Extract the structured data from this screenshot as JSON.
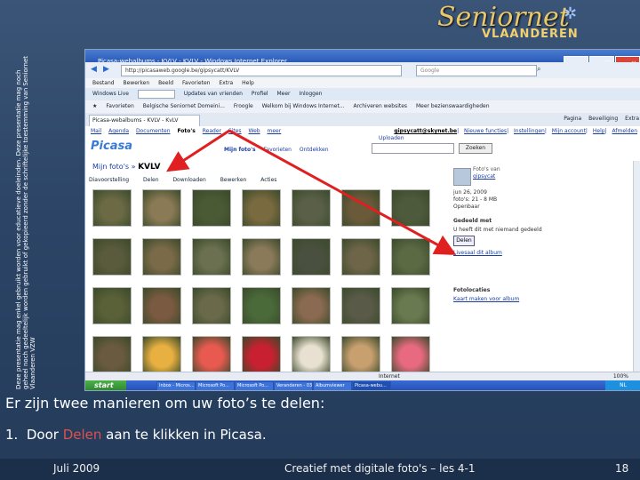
{
  "logo": {
    "main": "Seniornet",
    "sub": "VLAANDEREN"
  },
  "copyright": "Deze presentatie mag enkel gebruikt worden voor educatieve doeleinden. Deze presentatie mag noch geheel noch gedeeltelijk worden gebruikt of gekopieerd zonder de schriftelijke toestemming van Seniornet Vlaanderen VZW",
  "browser": {
    "title": "Picasa-webalbums - KVLV - KVLV - Windows Internet Explorer",
    "address": "http://picasaweb.google.be/gipsycatt/KVLV",
    "search_placeholder": "Google",
    "menu": [
      "Bestand",
      "Bewerken",
      "Beeld",
      "Favorieten",
      "Extra",
      "Help"
    ],
    "fav_items": [
      "Windows Live",
      "Updates van vrienden",
      "Profiel",
      "Meer",
      "Inloggen"
    ],
    "links": [
      "Favorieten",
      "Belgische Seniornet Domeini...",
      "Froogle",
      "Welkom bij Windows Internet...",
      "Archiveren websites",
      "Meer bezienswaardigheden"
    ],
    "tab": "Picasa-webalbums - KVLV - KvLV",
    "tab_tools": [
      "Pagina",
      "Beveiliging",
      "Extra"
    ],
    "status_zone": "Internet",
    "zoom": "100%"
  },
  "google_bar": {
    "links": [
      "Mail",
      "Agenda",
      "Documenten",
      "Foto's",
      "Reader",
      "Sites",
      "Web",
      "meer"
    ],
    "right": [
      "gipsycatt@skynet.be",
      "Nieuwe functies",
      "Instellingen",
      "Mijn account",
      "Help",
      "Afmelden"
    ]
  },
  "picasa": {
    "logo": "Picasa",
    "tabs": [
      "Mijn foto's",
      "Favorieten",
      "Ontdekken"
    ],
    "search_button": "Zoeken",
    "upload": "Uploaden",
    "album_path": "Mijn foto's",
    "album_name": "KVLV",
    "toolbar": [
      "Diavoorstelling",
      "Delen",
      "Downloaden",
      "Bewerken",
      "Acties"
    ],
    "sidebar": {
      "owner_label": "Foto's van",
      "owner": "gipsycat",
      "info": [
        "jun 26, 2009",
        "foto's: 21 - 8 MB",
        "Openbaar"
      ],
      "shared_heading": "Gedeeld met",
      "shared_text": "U heeft dit met niemand gedeeld",
      "share_button": "Delen",
      "rss": "Livesaal dit album",
      "location_heading": "Fotolocaties",
      "map_link": "Kaart maken voor album"
    }
  },
  "taskbar": {
    "start": "start",
    "tasks": [
      "Inbox - Micros...",
      "Microsoft Po...",
      "Microsoft Po...",
      "Veranderen - 03...",
      "Albumviewer",
      "Picasa-webu..."
    ],
    "clock": "NL"
  },
  "slide": {
    "intro": "Er zijn twee manieren om uw foto’s te delen:",
    "point_number": "1.",
    "point_pre": "Door ",
    "point_highlight": "Delen",
    "point_post": " aan te klikken in Picasa."
  },
  "footer": {
    "date": "Juli 2009",
    "course": "Creatief met digitale foto's – les 4-1",
    "page": "18"
  },
  "colors": {
    "arrow": "#e02020",
    "highlight": "#e05050",
    "background": "#2c4566"
  },
  "icons": [
    "star-icon",
    "ie-logo-icon",
    "picasa-logo-icon",
    "avatar-icon",
    "rss-icon",
    "windows-flag-icon"
  ]
}
